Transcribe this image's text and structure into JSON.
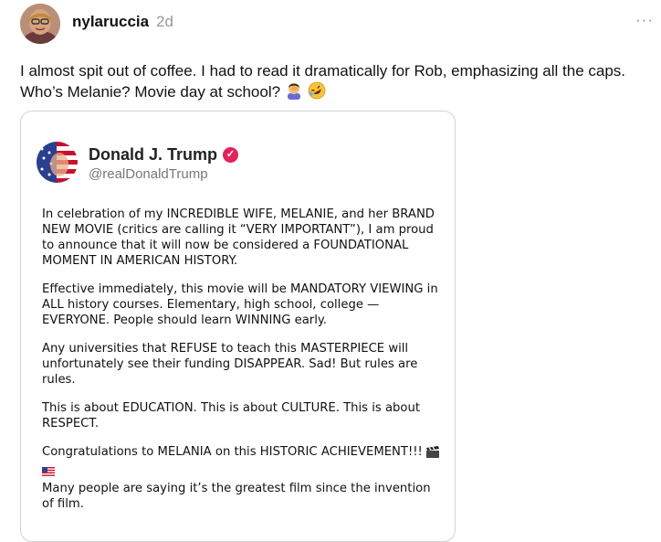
{
  "post": {
    "username": "nylaruccia",
    "time": "2d",
    "more": "···",
    "text_line1": "I almost spit out of coffee. I had to read it dramatically for Rob, emphasizing all the caps.",
    "text_line2": "Who’s Melanie? Movie day at school?"
  },
  "embed": {
    "name": "Donald J. Trump",
    "handle": "@realDonaldTrump",
    "paragraphs": [
      "In celebration of my INCREDIBLE WIFE, MELANIE, and her BRAND NEW MOVIE (critics are calling it “VERY IMPORTANT”), I am proud to announce that it will now be considered a FOUNDATIONAL MOMENT IN AMERICAN HISTORY.",
      "Effective immediately, this movie will be MANDATORY VIEWING in ALL history courses. Elementary, high school, college — EVERYONE. People should learn WINNING early.",
      "Any universities that REFUSE to teach this MASTERPIECE will unfortunately see their funding DISAPPEAR. Sad! But rules are rules.",
      "This is about EDUCATION. This is about CULTURE. This is about RESPECT.",
      "Congratulations to MELANIA on this HISTORIC ACHIEVEMENT!!!",
      "Many people are saying it’s the greatest film since the invention of film."
    ]
  },
  "colors": {
    "verified": "#e0245e",
    "muted": "#999999"
  },
  "icons": [
    "facepalm-emoji",
    "rofl-emoji",
    "clapperboard-emoji",
    "us-flag-emoji",
    "verified-badge-icon",
    "more-icon"
  ]
}
